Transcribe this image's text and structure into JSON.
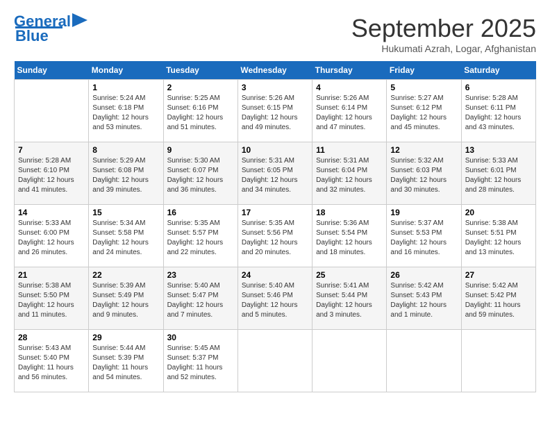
{
  "header": {
    "logo_general": "General",
    "logo_blue": "Blue",
    "month_title": "September 2025",
    "location": "Hukumati Azrah, Logar, Afghanistan"
  },
  "days_of_week": [
    "Sunday",
    "Monday",
    "Tuesday",
    "Wednesday",
    "Thursday",
    "Friday",
    "Saturday"
  ],
  "weeks": [
    [
      {
        "day": "",
        "sunrise": "",
        "sunset": "",
        "daylight": ""
      },
      {
        "day": "1",
        "sunrise": "Sunrise: 5:24 AM",
        "sunset": "Sunset: 6:18 PM",
        "daylight": "Daylight: 12 hours and 53 minutes."
      },
      {
        "day": "2",
        "sunrise": "Sunrise: 5:25 AM",
        "sunset": "Sunset: 6:16 PM",
        "daylight": "Daylight: 12 hours and 51 minutes."
      },
      {
        "day": "3",
        "sunrise": "Sunrise: 5:26 AM",
        "sunset": "Sunset: 6:15 PM",
        "daylight": "Daylight: 12 hours and 49 minutes."
      },
      {
        "day": "4",
        "sunrise": "Sunrise: 5:26 AM",
        "sunset": "Sunset: 6:14 PM",
        "daylight": "Daylight: 12 hours and 47 minutes."
      },
      {
        "day": "5",
        "sunrise": "Sunrise: 5:27 AM",
        "sunset": "Sunset: 6:12 PM",
        "daylight": "Daylight: 12 hours and 45 minutes."
      },
      {
        "day": "6",
        "sunrise": "Sunrise: 5:28 AM",
        "sunset": "Sunset: 6:11 PM",
        "daylight": "Daylight: 12 hours and 43 minutes."
      }
    ],
    [
      {
        "day": "7",
        "sunrise": "Sunrise: 5:28 AM",
        "sunset": "Sunset: 6:10 PM",
        "daylight": "Daylight: 12 hours and 41 minutes."
      },
      {
        "day": "8",
        "sunrise": "Sunrise: 5:29 AM",
        "sunset": "Sunset: 6:08 PM",
        "daylight": "Daylight: 12 hours and 39 minutes."
      },
      {
        "day": "9",
        "sunrise": "Sunrise: 5:30 AM",
        "sunset": "Sunset: 6:07 PM",
        "daylight": "Daylight: 12 hours and 36 minutes."
      },
      {
        "day": "10",
        "sunrise": "Sunrise: 5:31 AM",
        "sunset": "Sunset: 6:05 PM",
        "daylight": "Daylight: 12 hours and 34 minutes."
      },
      {
        "day": "11",
        "sunrise": "Sunrise: 5:31 AM",
        "sunset": "Sunset: 6:04 PM",
        "daylight": "Daylight: 12 hours and 32 minutes."
      },
      {
        "day": "12",
        "sunrise": "Sunrise: 5:32 AM",
        "sunset": "Sunset: 6:03 PM",
        "daylight": "Daylight: 12 hours and 30 minutes."
      },
      {
        "day": "13",
        "sunrise": "Sunrise: 5:33 AM",
        "sunset": "Sunset: 6:01 PM",
        "daylight": "Daylight: 12 hours and 28 minutes."
      }
    ],
    [
      {
        "day": "14",
        "sunrise": "Sunrise: 5:33 AM",
        "sunset": "Sunset: 6:00 PM",
        "daylight": "Daylight: 12 hours and 26 minutes."
      },
      {
        "day": "15",
        "sunrise": "Sunrise: 5:34 AM",
        "sunset": "Sunset: 5:58 PM",
        "daylight": "Daylight: 12 hours and 24 minutes."
      },
      {
        "day": "16",
        "sunrise": "Sunrise: 5:35 AM",
        "sunset": "Sunset: 5:57 PM",
        "daylight": "Daylight: 12 hours and 22 minutes."
      },
      {
        "day": "17",
        "sunrise": "Sunrise: 5:35 AM",
        "sunset": "Sunset: 5:56 PM",
        "daylight": "Daylight: 12 hours and 20 minutes."
      },
      {
        "day": "18",
        "sunrise": "Sunrise: 5:36 AM",
        "sunset": "Sunset: 5:54 PM",
        "daylight": "Daylight: 12 hours and 18 minutes."
      },
      {
        "day": "19",
        "sunrise": "Sunrise: 5:37 AM",
        "sunset": "Sunset: 5:53 PM",
        "daylight": "Daylight: 12 hours and 16 minutes."
      },
      {
        "day": "20",
        "sunrise": "Sunrise: 5:38 AM",
        "sunset": "Sunset: 5:51 PM",
        "daylight": "Daylight: 12 hours and 13 minutes."
      }
    ],
    [
      {
        "day": "21",
        "sunrise": "Sunrise: 5:38 AM",
        "sunset": "Sunset: 5:50 PM",
        "daylight": "Daylight: 12 hours and 11 minutes."
      },
      {
        "day": "22",
        "sunrise": "Sunrise: 5:39 AM",
        "sunset": "Sunset: 5:49 PM",
        "daylight": "Daylight: 12 hours and 9 minutes."
      },
      {
        "day": "23",
        "sunrise": "Sunrise: 5:40 AM",
        "sunset": "Sunset: 5:47 PM",
        "daylight": "Daylight: 12 hours and 7 minutes."
      },
      {
        "day": "24",
        "sunrise": "Sunrise: 5:40 AM",
        "sunset": "Sunset: 5:46 PM",
        "daylight": "Daylight: 12 hours and 5 minutes."
      },
      {
        "day": "25",
        "sunrise": "Sunrise: 5:41 AM",
        "sunset": "Sunset: 5:44 PM",
        "daylight": "Daylight: 12 hours and 3 minutes."
      },
      {
        "day": "26",
        "sunrise": "Sunrise: 5:42 AM",
        "sunset": "Sunset: 5:43 PM",
        "daylight": "Daylight: 12 hours and 1 minute."
      },
      {
        "day": "27",
        "sunrise": "Sunrise: 5:42 AM",
        "sunset": "Sunset: 5:42 PM",
        "daylight": "Daylight: 11 hours and 59 minutes."
      }
    ],
    [
      {
        "day": "28",
        "sunrise": "Sunrise: 5:43 AM",
        "sunset": "Sunset: 5:40 PM",
        "daylight": "Daylight: 11 hours and 56 minutes."
      },
      {
        "day": "29",
        "sunrise": "Sunrise: 5:44 AM",
        "sunset": "Sunset: 5:39 PM",
        "daylight": "Daylight: 11 hours and 54 minutes."
      },
      {
        "day": "30",
        "sunrise": "Sunrise: 5:45 AM",
        "sunset": "Sunset: 5:37 PM",
        "daylight": "Daylight: 11 hours and 52 minutes."
      },
      {
        "day": "",
        "sunrise": "",
        "sunset": "",
        "daylight": ""
      },
      {
        "day": "",
        "sunrise": "",
        "sunset": "",
        "daylight": ""
      },
      {
        "day": "",
        "sunrise": "",
        "sunset": "",
        "daylight": ""
      },
      {
        "day": "",
        "sunrise": "",
        "sunset": "",
        "daylight": ""
      }
    ]
  ]
}
